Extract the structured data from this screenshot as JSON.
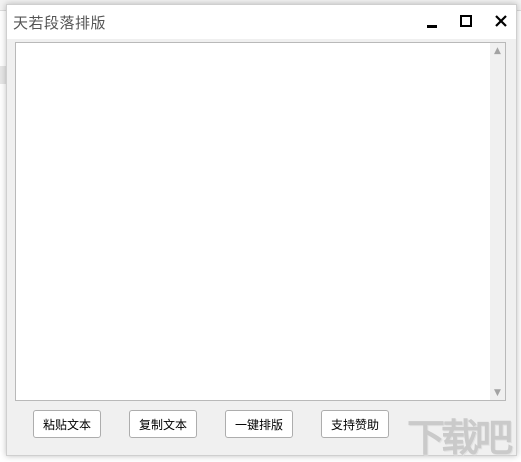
{
  "window": {
    "title": "天若段落排版"
  },
  "editor": {
    "value": "",
    "placeholder": ""
  },
  "buttons": {
    "paste": "粘贴文本",
    "copy": "复制文本",
    "format": "一键排版",
    "donate": "支持赞助"
  },
  "icons": {
    "minimize": "minimize-icon",
    "maximize": "maximize-icon",
    "close": "close-icon",
    "scroll_up": "scroll-up-arrow-icon",
    "scroll_down": "scroll-down-arrow-icon"
  },
  "watermark": {
    "text": "下载吧"
  },
  "colors": {
    "window_bg": "#f0f0f0",
    "titlebar_bg": "#ffffff",
    "title_text": "#555555",
    "button_border": "#adadad"
  }
}
